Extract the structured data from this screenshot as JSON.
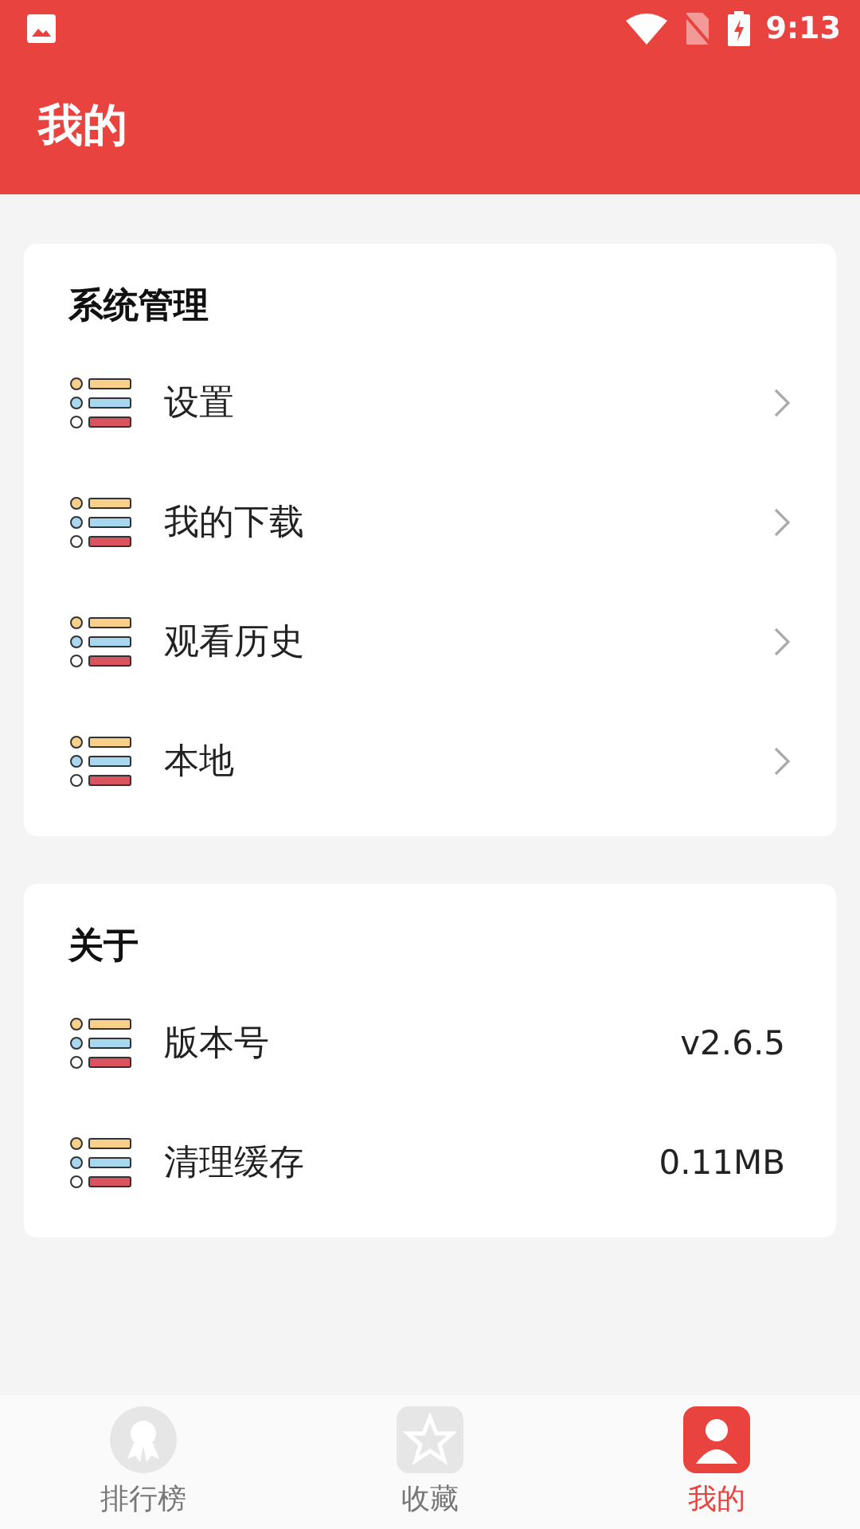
{
  "status_bar": {
    "time": "9:13"
  },
  "header": {
    "title": "我的"
  },
  "sections": [
    {
      "title": "系统管理",
      "items": [
        {
          "label": "设置",
          "kind": "link"
        },
        {
          "label": "我的下载",
          "kind": "link"
        },
        {
          "label": "观看历史",
          "kind": "link"
        },
        {
          "label": "本地",
          "kind": "link"
        }
      ]
    },
    {
      "title": "关于",
      "items": [
        {
          "label": "版本号",
          "kind": "value",
          "value": "v2.6.5"
        },
        {
          "label": "清理缓存",
          "kind": "value",
          "value": "0.11MB"
        }
      ]
    }
  ],
  "tabs": [
    {
      "label": "排行榜",
      "kind": "ribbon",
      "selected": false
    },
    {
      "label": "收藏",
      "kind": "star",
      "selected": false
    },
    {
      "label": "我的",
      "kind": "person",
      "selected": true
    }
  ]
}
